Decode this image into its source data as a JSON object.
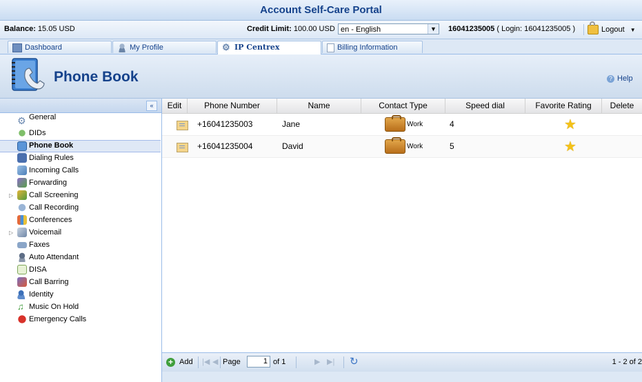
{
  "app": {
    "title": "Account Self-Care Portal"
  },
  "infobar": {
    "balance_label": "Balance:",
    "balance_value": "15.05 USD",
    "credit_label": "Credit Limit:",
    "credit_value": "100.00 USD",
    "language": "en - English",
    "account_number": "16041235005",
    "login_text": "( Login: 16041235005 )",
    "logout_label": "Logout"
  },
  "tabs": [
    {
      "label": "Dashboard",
      "icon": "dashboard-icon"
    },
    {
      "label": "My Profile",
      "icon": "user-icon"
    },
    {
      "label": "IP Centrex",
      "icon": "gear-icon",
      "active": true
    },
    {
      "label": "Billing Information",
      "icon": "document-icon"
    }
  ],
  "header": {
    "title": "Phone Book",
    "help_label": "Help"
  },
  "sidebar": {
    "collapse_symbol": "«",
    "items": [
      {
        "label": "General",
        "icon": "gear-icon"
      },
      {
        "label": "DIDs",
        "icon": "did-icon"
      },
      {
        "label": "Phone Book",
        "icon": "phonebook-icon",
        "selected": true
      },
      {
        "label": "Dialing Rules",
        "icon": "dialing-rules-icon"
      },
      {
        "label": "Incoming Calls",
        "icon": "incoming-calls-icon"
      },
      {
        "label": "Forwarding",
        "icon": "forwarding-icon"
      },
      {
        "label": "Call Screening",
        "icon": "call-screening-icon",
        "expandable": true
      },
      {
        "label": "Call Recording",
        "icon": "call-recording-icon"
      },
      {
        "label": "Conferences",
        "icon": "conferences-icon"
      },
      {
        "label": "Voicemail",
        "icon": "voicemail-icon",
        "expandable": true
      },
      {
        "label": "Faxes",
        "icon": "fax-icon"
      },
      {
        "label": "Auto Attendant",
        "icon": "auto-attendant-icon"
      },
      {
        "label": "DISA",
        "icon": "disa-icon"
      },
      {
        "label": "Call Barring",
        "icon": "call-barring-icon"
      },
      {
        "label": "Identity",
        "icon": "identity-icon"
      },
      {
        "label": "Music On Hold",
        "icon": "music-icon"
      },
      {
        "label": "Emergency Calls",
        "icon": "emergency-icon"
      }
    ]
  },
  "grid": {
    "columns": [
      "Edit",
      "Phone Number",
      "Name",
      "Contact Type",
      "Speed dial",
      "Favorite Rating",
      "Delete"
    ],
    "rows": [
      {
        "phone": "+16041235003",
        "name": "Jane",
        "contact_type": "Work",
        "speed_dial": "4",
        "favorite": true
      },
      {
        "phone": "+16041235004",
        "name": "David",
        "contact_type": "Work",
        "speed_dial": "5",
        "favorite": true
      }
    ]
  },
  "pager": {
    "add_label": "Add",
    "page_label": "Page",
    "current_page": "1",
    "of_label": "of 1",
    "display_text": "1 - 2 of 2"
  },
  "colors": {
    "accent": "#15428b",
    "header_bg": "#cddced",
    "selected_row": "#dfe8f6"
  }
}
